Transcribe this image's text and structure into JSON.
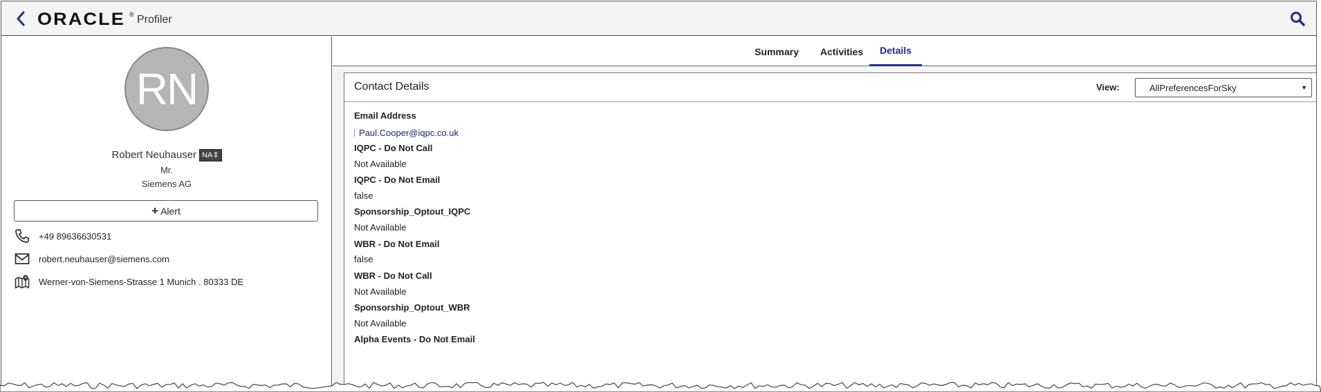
{
  "header": {
    "back_icon": "chevron-left-icon",
    "logo": "ORACLE",
    "logo_reg": "®",
    "app_name": "Profiler",
    "search_icon": "search-icon",
    "accent_color": "#1b2f8e"
  },
  "profile": {
    "initials": "RN",
    "name": "Robert Neuhauser",
    "badge": "NA",
    "title": "Mr.",
    "company": "Siemens AG",
    "alert_button": "Alert",
    "phone": "+49 89636630531",
    "email": "robert.neuhauser@siemens.com",
    "address": "Werner-von-Siemens-Strasse 1 Munich . 80333 DE"
  },
  "tabs": [
    {
      "label": "Summary",
      "active": false
    },
    {
      "label": "Activities",
      "active": false
    },
    {
      "label": "Details",
      "active": true
    }
  ],
  "details": {
    "card_title": "Contact Details",
    "view_label": "View:",
    "view_selected": "AllPreferencesForSky",
    "fields": [
      {
        "label": "Email Address",
        "value": "Paul.Cooper@iqpc.co.uk"
      },
      {
        "label": "IQPC - Do Not Call",
        "value": "Not Available"
      },
      {
        "label": "IQPC - Do Not Email",
        "value": "false"
      },
      {
        "label": "Sponsorship_Optout_IQPC",
        "value": "Not Available"
      },
      {
        "label": "WBR - Do Not Email",
        "value": "false"
      },
      {
        "label": "WBR - Do Not Call",
        "value": "Not Available"
      },
      {
        "label": "Sponsorship_Optout_WBR",
        "value": "Not Available"
      },
      {
        "label": "Alpha Events - Do Not Email",
        "value": ""
      }
    ]
  }
}
